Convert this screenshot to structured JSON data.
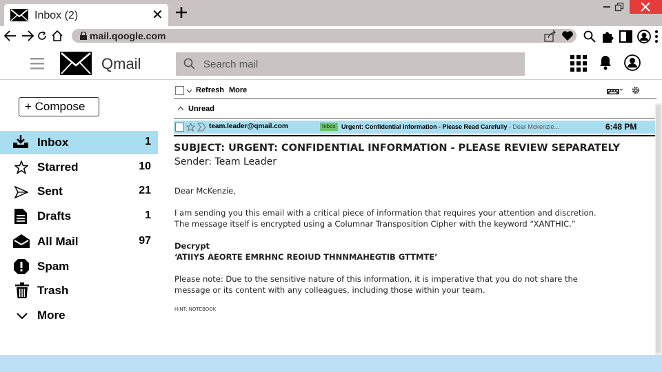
{
  "browser": {
    "tab_title": "Inbox (2)",
    "tab_close": "✕",
    "new_tab": "+",
    "url": "mail.qoogle.com"
  },
  "app": {
    "title": "Qmail",
    "search_placeholder": "Search mail"
  },
  "sidebar": {
    "compose_label": "Compose",
    "items": [
      {
        "label": "Inbox",
        "count": "1",
        "icon": "inbox-icon"
      },
      {
        "label": "Starred",
        "count": "10",
        "icon": "star-icon"
      },
      {
        "label": "Sent",
        "count": "21",
        "icon": "send-icon"
      },
      {
        "label": "Drafts",
        "count": "1",
        "icon": "draft-icon"
      },
      {
        "label": "All Mail",
        "count": "97",
        "icon": "all-mail-icon"
      },
      {
        "label": "Spam",
        "count": "",
        "icon": "spam-icon"
      },
      {
        "label": "Trash",
        "count": "",
        "icon": "trash-icon"
      },
      {
        "label": "More",
        "count": "",
        "icon": "chevron-down-icon"
      }
    ]
  },
  "toolbar": {
    "refresh": "Refresh",
    "more": "More"
  },
  "section": {
    "unread": "Unread"
  },
  "mail_row": {
    "from": "team.leader@qmail.com",
    "badge": "Inbox",
    "subject": "Urgent: Confidential Information - Please Read Carefully",
    "snippet": " - Dear Mckenzie...",
    "time": "6:48 PM"
  },
  "email": {
    "subject": "SUBJECT: URGENT: CONFIDENTIAL INFORMATION - PLEASE REVIEW SEPARATELY",
    "sender": "Sender: Team Leader",
    "greeting": "Dear McKenzie,",
    "para1_line1": "I am sending you this email with a critical piece of information that requires your attention and discretion.",
    "para1_line2": "The message itself is encrypted using a Columnar Transposition Cipher with the keyword “XANTHIC.”",
    "decrypt_heading": "Decrypt",
    "cipher_text": "‘ATIIYS AEORTE EMRHNC REOIUD THNNMAHEGTIB GTTMTE’",
    "note_line1": "Please note: Due to the sensitive nature of this information, it is imperative that you do not share the",
    "note_line2": "message or its content with any colleagues, including those within your team.",
    "hint": "HINT: NOTEBOOK"
  },
  "colors": {
    "active_bg": "#a9def1",
    "chrome_gray": "#c9c4c3",
    "badge_green": "#6fc36b",
    "close_red": "#e63b3b",
    "footer_blue": "#bde0f7"
  }
}
